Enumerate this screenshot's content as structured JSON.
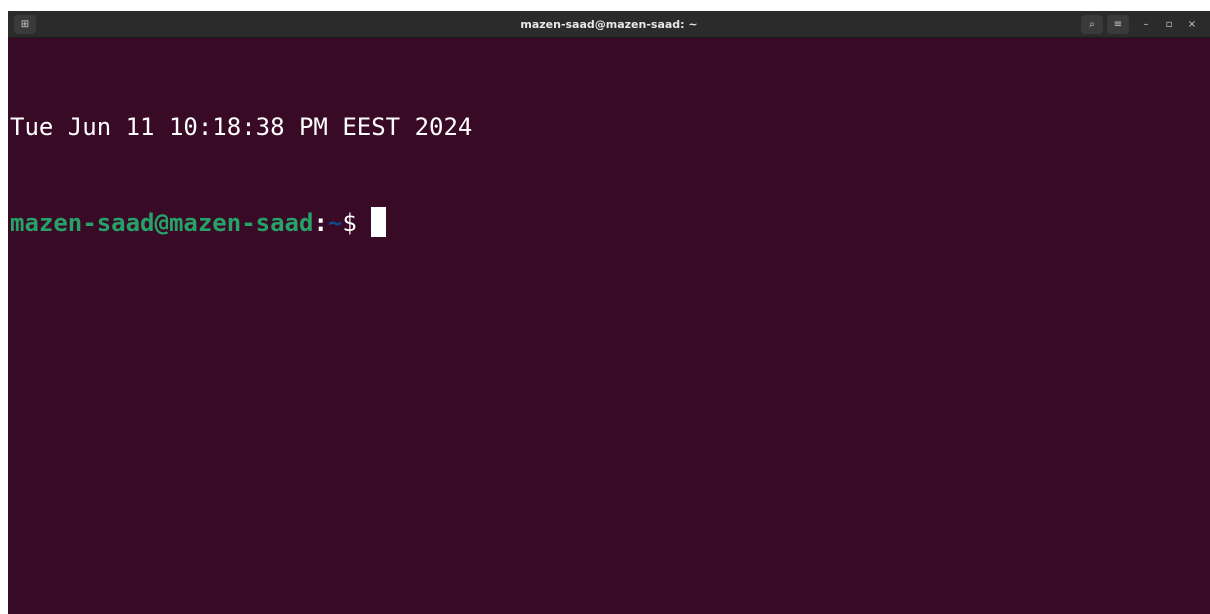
{
  "window": {
    "title": "mazen-saad@mazen-saad: ~"
  },
  "titlebar": {
    "new_tab_icon": "⊞",
    "search_icon": "⌕",
    "menu_icon": "≡",
    "minimize_icon": "–",
    "maximize_icon": "▫",
    "close_icon": "×"
  },
  "terminal": {
    "lines": [
      {
        "text": "Tue Jun 11 10:18:38 PM EEST 2024"
      }
    ],
    "prompt": {
      "user_host": "mazen-saad@mazen-saad",
      "separator": ":",
      "path": "~",
      "symbol": "$ "
    }
  },
  "colors": {
    "background": "#380a26",
    "user": "#26a269",
    "path": "#12488b",
    "text": "#ffffff"
  }
}
